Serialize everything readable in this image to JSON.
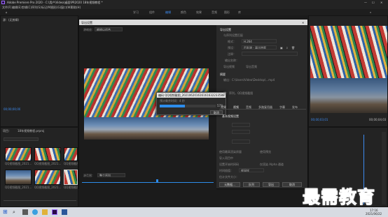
{
  "app": {
    "title": "Adobe Premiere Pro 2020 - C:\\用户\\Video\\桌面\\PR2020  18年视频教程 *",
    "menu": [
      "文件(F)",
      "编辑(E)",
      "剪辑(C)",
      "序列(S)",
      "标记(M)",
      "图形(G)",
      "窗口(W)",
      "帮助(H)"
    ],
    "workspaces": [
      "学习",
      "组件",
      "编辑",
      "颜色",
      "效果",
      "音频",
      "图形",
      "库"
    ],
    "active_workspace": "编辑"
  },
  "export_dialog": {
    "title": "导出设置",
    "source_label": "源缩放：",
    "source_value": "缩放以适合",
    "export_settings_header": "导出设置",
    "match_sequence": "与序列设置匹配",
    "format_label": "格式：",
    "format_value": "H.264",
    "preset_label": "预设：",
    "preset_value": "匹配源 - 高比特率",
    "comment_label": "注释：",
    "output_name_label": "输出名称：",
    "export_video": "导出视频",
    "export_audio": "导出音频",
    "summary_header": "摘要",
    "summary_output": "输出：C:\\Users\\Video\\Desktop\\...mp4",
    "summary_source": "源：序列，QQ视频截图",
    "tabs": [
      "效果",
      "视频",
      "音频",
      "多路复用器",
      "字幕",
      "发布"
    ],
    "basic_settings": "基本视频设置",
    "max_render": "使用最高渲染质量",
    "use_previews": "使用预览",
    "import_project": "导入项目中",
    "set_start_timecode": "设置开始时间码",
    "render_alpha": "仅渲染 Alpha 通道",
    "time_interpolation": "时间插值：",
    "time_interpolation_value": "帧采样",
    "file_size": "估计文件大小：",
    "metadata_button": "元数据...",
    "queue_button": "队列",
    "export_button": "导出",
    "cancel_button": "取消",
    "source_range": "源范围：",
    "source_range_value": "整个序列"
  },
  "progress": {
    "title": "编码 QQ视频截图_20210620161616163223358819",
    "eta_label": "预计剩余时间：4 秒",
    "percent": "57%",
    "fraction": 0.45,
    "cancel_label": "取消"
  },
  "left_monitor": {
    "timecode": "00;00;00;00",
    "tab": "源：(无剪辑)"
  },
  "right_monitor": {
    "timecode_left": "00;00;03;01",
    "timecode_right": "00;00;04;03"
  },
  "project": {
    "tabs": [
      "项目：",
      "18年视频教程.prproj"
    ],
    "items": [
      {
        "name": "QQ视频截图_2021..."
      },
      {
        "name": "QQ视频截图_2021..."
      },
      {
        "name": "QQ视频截图_2021..."
      },
      {
        "name": "QQ视频截图_2021..."
      },
      {
        "name": "QQ视频截图_2021..."
      },
      {
        "name": "QQ视频截图_2021..."
      }
    ]
  },
  "watermark": "最需教育",
  "taskbar": {
    "time": "17:16",
    "date": "2021/06/22"
  },
  "colors": {
    "accent": "#2d8ceb",
    "watermark": "#1d57c9"
  }
}
